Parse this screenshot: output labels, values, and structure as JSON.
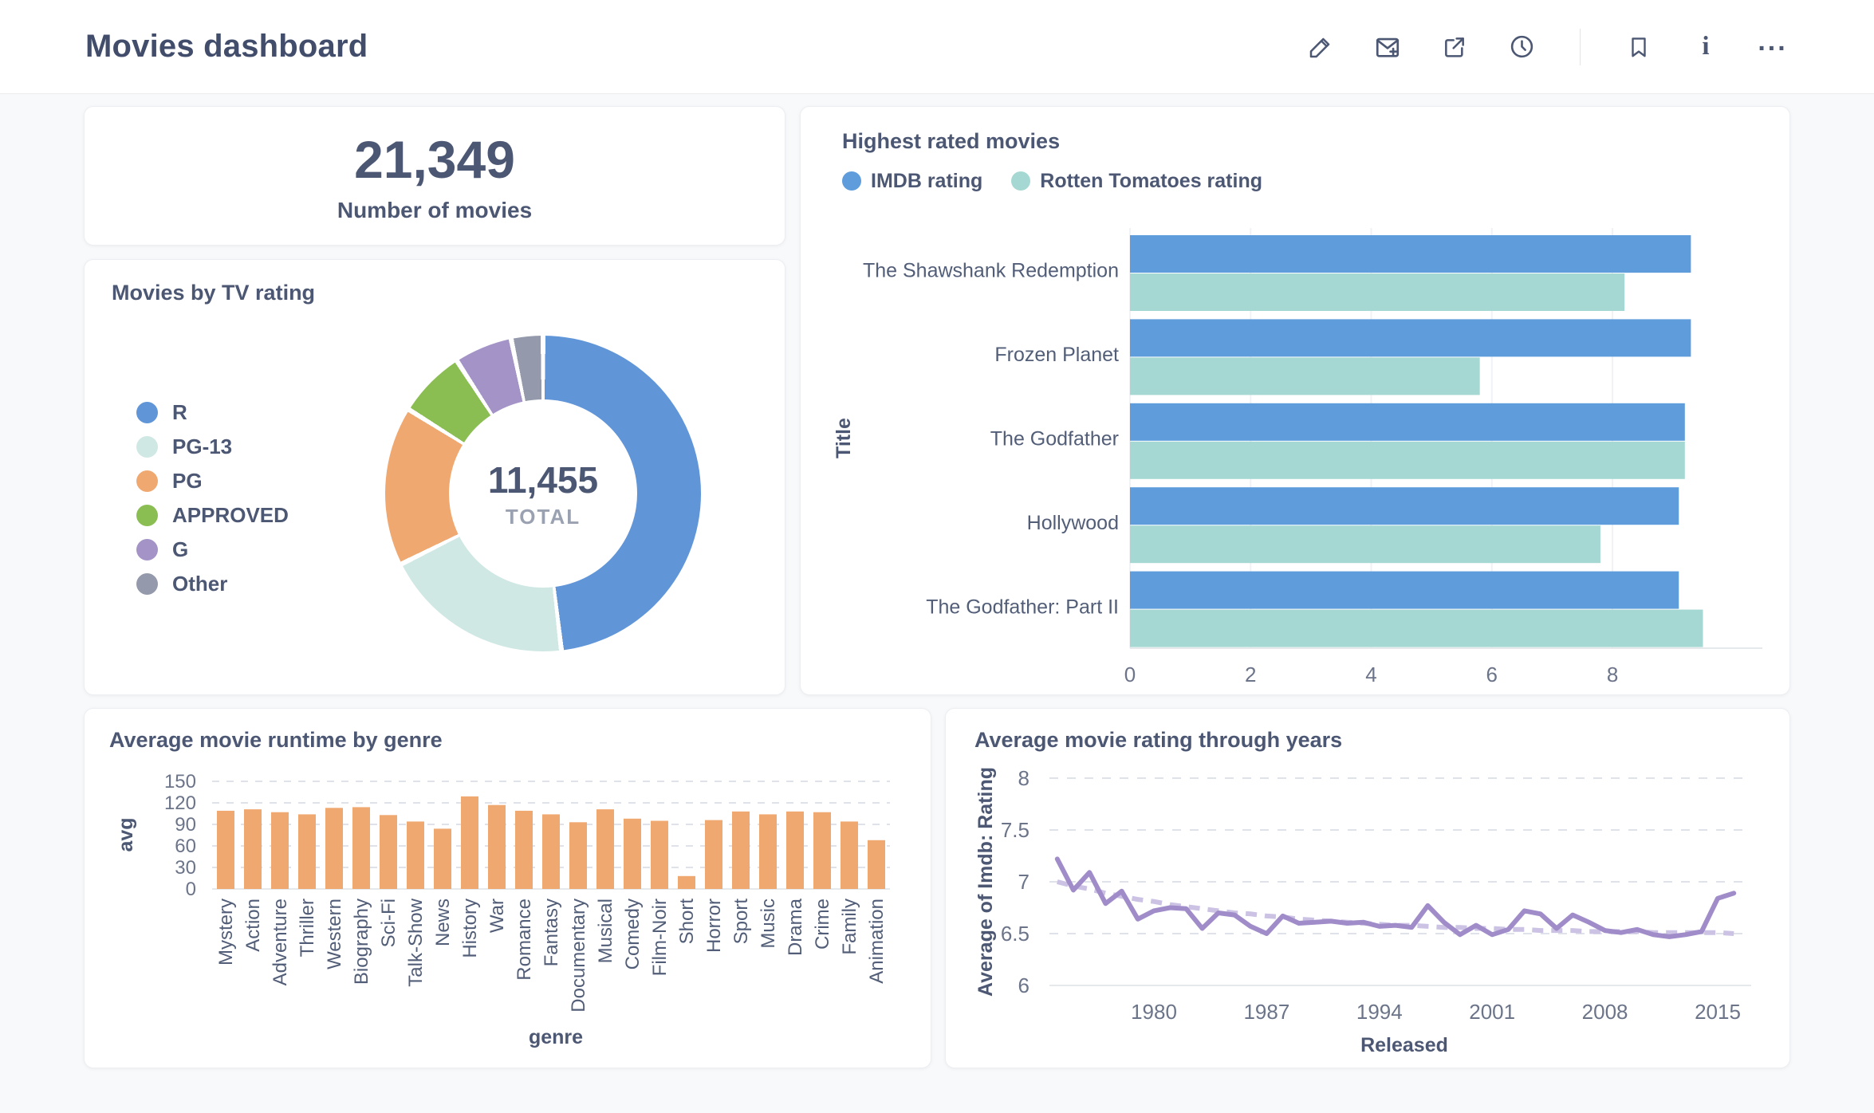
{
  "header": {
    "title": "Movies dashboard",
    "icons": [
      {
        "id": "edit-pencil",
        "label": "Edit dashboard"
      },
      {
        "id": "subscriptions-mail",
        "label": "Subscriptions"
      },
      {
        "id": "sharing-external",
        "label": "Sharing"
      },
      {
        "id": "auto-refresh-clock",
        "label": "Auto-refresh"
      },
      {
        "id": "bookmark",
        "label": "Bookmark"
      },
      {
        "id": "info",
        "label": "Info"
      },
      {
        "id": "more-options",
        "label": "More options"
      }
    ]
  },
  "cards": {
    "number": {
      "value": "21,349",
      "label": "Number of movies"
    }
  },
  "chart_data": [
    {
      "type": "pie",
      "title": "Movies by TV rating",
      "labels": [
        "R",
        "PG-13",
        "PG",
        "APPROVED",
        "G",
        "Other"
      ],
      "values": [
        5515,
        2234,
        1861,
        795,
        678,
        372
      ],
      "colors": [
        "#6095D8",
        "#CFE8E3",
        "#F0A871",
        "#8BBE52",
        "#A393C6",
        "#949AAB"
      ],
      "total": 11455,
      "total_display": "11,455",
      "total_label": "TOTAL",
      "legend_position": "left"
    },
    {
      "type": "bar",
      "orientation": "horizontal",
      "title": "Highest rated movies",
      "categories": [
        "The Shawshank Redemption",
        "Frozen Planet",
        "The Godfather",
        "Hollywood",
        "The Godfather: Part II"
      ],
      "series": [
        {
          "name": "IMDB rating",
          "color": "#5E9CDC",
          "values": [
            9.3,
            9.3,
            9.2,
            9.1,
            9.1
          ]
        },
        {
          "name": "Rotten Tomatoes rating",
          "color": "#A5D8D2",
          "values": [
            8.2,
            5.8,
            9.2,
            7.8,
            9.5
          ]
        }
      ],
      "ylabel": "Title",
      "xlim": [
        0,
        10.3
      ],
      "xticks": [
        0,
        2,
        4,
        6,
        8
      ],
      "grid": "vertical"
    },
    {
      "type": "bar",
      "orientation": "vertical",
      "title": "Average movie runtime by genre",
      "categories": [
        "Mystery",
        "Action",
        "Adventure",
        "Thriller",
        "Western",
        "Biography",
        "Sci-Fi",
        "Talk-Show",
        "News",
        "History",
        "War",
        "Romance",
        "Fantasy",
        "Documentary",
        "Musical",
        "Comedy",
        "Film-Noir",
        "Short",
        "Horror",
        "Sport",
        "Music",
        "Drama",
        "Crime",
        "Family",
        "Animation"
      ],
      "values": [
        109,
        111,
        107,
        104,
        113,
        114,
        103,
        94,
        84,
        129,
        117,
        109,
        104,
        93,
        111,
        98,
        95,
        18,
        96,
        108,
        104,
        108,
        107,
        94,
        68
      ],
      "color": "#F0A871",
      "xlabel": "genre",
      "ylabel": "avg",
      "ylim": [
        0,
        150
      ],
      "yticks": [
        0,
        30,
        60,
        90,
        120,
        150
      ],
      "grid": "horizontal-dashed"
    },
    {
      "type": "line",
      "title": "Average movie rating through years",
      "x": [
        1974,
        1975,
        1976,
        1977,
        1978,
        1979,
        1980,
        1981,
        1982,
        1983,
        1984,
        1985,
        1986,
        1987,
        1988,
        1989,
        1990,
        1991,
        1992,
        1993,
        1994,
        1995,
        1996,
        1997,
        1998,
        1999,
        2000,
        2001,
        2002,
        2003,
        2004,
        2005,
        2006,
        2007,
        2008,
        2009,
        2010,
        2011,
        2012,
        2013,
        2014,
        2015,
        2016
      ],
      "values": [
        7.22,
        6.92,
        7.09,
        6.79,
        6.91,
        6.64,
        6.72,
        6.75,
        6.74,
        6.55,
        6.7,
        6.68,
        6.57,
        6.5,
        6.67,
        6.6,
        6.61,
        6.62,
        6.6,
        6.61,
        6.57,
        6.58,
        6.56,
        6.77,
        6.61,
        6.49,
        6.58,
        6.49,
        6.54,
        6.72,
        6.69,
        6.55,
        6.68,
        6.61,
        6.53,
        6.51,
        6.54,
        6.49,
        6.47,
        6.49,
        6.52,
        6.84,
        6.89
      ],
      "trend": [
        7.0,
        6.96,
        6.93,
        6.89,
        6.86,
        6.83,
        6.81,
        6.78,
        6.76,
        6.74,
        6.72,
        6.7,
        6.69,
        6.67,
        6.66,
        6.64,
        6.63,
        6.62,
        6.61,
        6.6,
        6.59,
        6.58,
        6.58,
        6.57,
        6.56,
        6.56,
        6.55,
        6.55,
        6.54,
        6.54,
        6.53,
        6.53,
        6.53,
        6.52,
        6.52,
        6.52,
        6.52,
        6.51,
        6.51,
        6.51,
        6.51,
        6.51,
        6.5
      ],
      "color": "#A08CC8",
      "trend_color": "#CCC2E4",
      "xlabel": "Released",
      "ylabel": "Average of Imdb: Rating",
      "ylim": [
        6,
        8
      ],
      "yticks": [
        6,
        6.5,
        7,
        7.5,
        8
      ],
      "xticks": [
        1980,
        1987,
        1994,
        2001,
        2008,
        2015
      ],
      "grid": "horizontal-dashed"
    }
  ]
}
